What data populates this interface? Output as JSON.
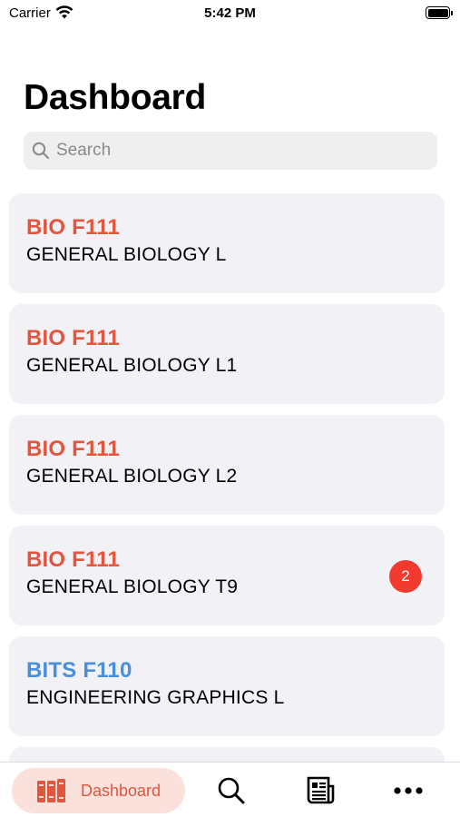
{
  "status_bar": {
    "carrier": "Carrier",
    "time": "5:42 PM"
  },
  "header": {
    "title": "Dashboard"
  },
  "search": {
    "placeholder": "Search",
    "value": ""
  },
  "courses": [
    {
      "code": "BIO F111",
      "name": "GENERAL BIOLOGY L",
      "code_color": "#e2553e",
      "badge": ""
    },
    {
      "code": "BIO F111",
      "name": "GENERAL BIOLOGY L1",
      "code_color": "#e2553e",
      "badge": ""
    },
    {
      "code": "BIO F111",
      "name": "GENERAL BIOLOGY L2",
      "code_color": "#e2553e",
      "badge": ""
    },
    {
      "code": "BIO F111",
      "name": "GENERAL BIOLOGY T9",
      "code_color": "#e2553e",
      "badge": "2"
    },
    {
      "code": "BITS F110",
      "name": "ENGINEERING GRAPHICS L",
      "code_color": "#4a8fd9",
      "badge": ""
    }
  ],
  "tab_bar": {
    "active_tab": "Dashboard",
    "tabs": [
      {
        "label": "Dashboard",
        "icon": "books-icon"
      },
      {
        "label": "",
        "icon": "search-icon"
      },
      {
        "label": "",
        "icon": "newspaper-icon"
      },
      {
        "label": "",
        "icon": "more-icon"
      }
    ]
  },
  "colors": {
    "accent": "#e2553e",
    "accent_tint": "#fbe1db",
    "badge": "#f23a2f",
    "card_bg": "#f2f2f6",
    "search_bg": "#efeff0"
  }
}
